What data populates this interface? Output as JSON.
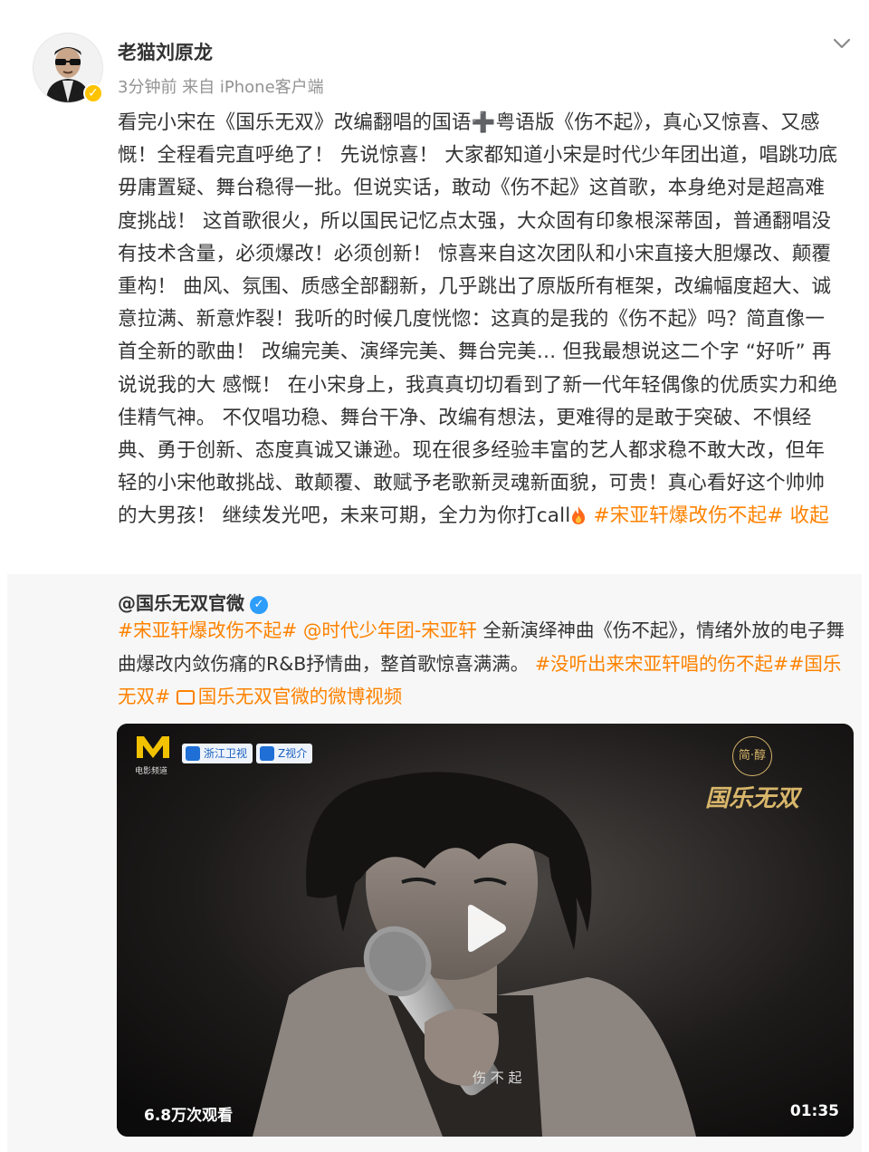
{
  "post": {
    "author": "老猫刘原龙",
    "meta": "3分钟前  来自 iPhone客户端",
    "text_segments": [
      {
        "t": "看完小宋在《国乐无双》改编翻唱的国语➕粤语版《伤不起》，真心又惊喜、又感慨！全程看完直呼绝了！ 先说惊喜！ 大家都知道小宋是时代少年团出道，唱跳功底毋庸置疑、舞台稳得一批。但说实话，敢动《伤不起》这首歌，本身绝对是超高难度挑战！ 这首歌很火，所以国民记忆点太强，大众固有印象根深蒂固，普通翻唱没有技术含量，必须爆改！必须创新！ 惊喜来自这次团队和小宋直接大胆爆改、颠覆重构！ 曲风、氛围、质感全部翻新，几乎跳出了原版所有框架，改编幅度超大、诚意拉满、新意炸裂！我听的时候几度恍惚：这真的是我的《伤不起》吗？简直像一首全新的歌曲！ 改编完美、演绎完美、舞台完美… 但我最想说这二个字 “好听” 再说说我的大 感慨！ 在小宋身上，我真真切切看到了新一代年轻偶像的优质实力和绝佳精气神。 不仅唱功稳、舞台干净、改编有想法，更难得的是敢于突破、不惧经典、勇于创新、态度真诚又谦逊。现在很多经验丰富的艺人都求稳不敢大改，但年轻的小宋他敢挑战、敢颠覆、敢赋予老歌新灵魂新面貌，可贵！真心看好这个帅帅的大男孩！ 继续发光吧，未来可期，全力为你打call"
      },
      {
        "t": " #宋亚轩爆改伤不起#",
        "tag": true
      },
      {
        "t": " 收起",
        "tag": true
      }
    ],
    "hashtag": "#宋亚轩爆改伤不起#",
    "collapse": "收起"
  },
  "repost": {
    "author": "@国乐无双官微",
    "tag1": "#宋亚轩爆改伤不起#",
    "mention": "@时代少年团-宋亚轩",
    "text1": " 全新演绎神曲《伤不起》，情绪外放的电子舞曲爆改内敛伤痛的R&B抒情曲，整首歌惊喜满满。",
    "tag2": "#没听出来宋亚轩唱的伤不起#",
    "tag3": "#国乐无双#",
    "video_link": "国乐无双官微的微博视频",
    "video": {
      "views": "6.8万次观看",
      "duration": "01:35",
      "channel1": "浙江卫视",
      "channel2": "Z视介",
      "logo_caption": "电影频道",
      "show_logo": "国乐无双",
      "show_logo_top": "简·醇",
      "subtitle": "伤 不 起"
    }
  },
  "colors": {
    "tag": "#ff8200",
    "meta": "#939393",
    "verified_personal": "#ffc300",
    "verified_org": "#2e9dfb"
  },
  "icons": [
    "more-chevron-icon",
    "verified-badge-icon",
    "fire-icon",
    "video-link-icon",
    "play-icon"
  ]
}
